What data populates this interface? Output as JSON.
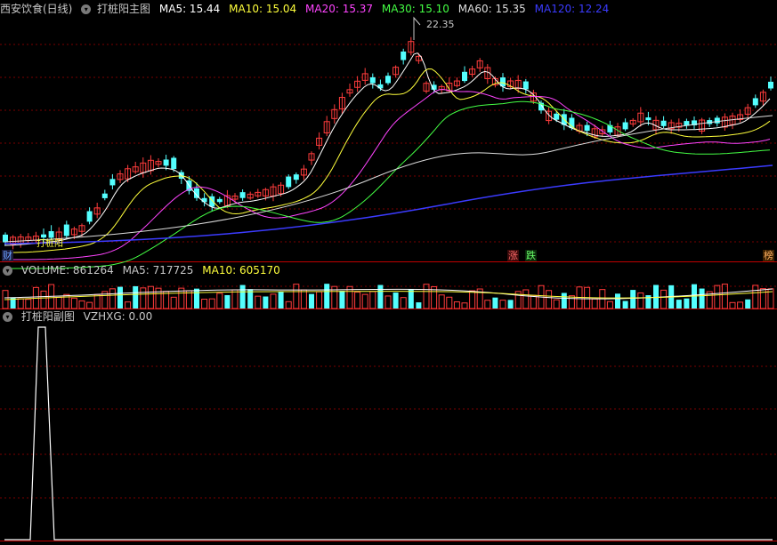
{
  "main_panel": {
    "stock_name": "西安饮食(日线)",
    "indicator_name": "打桩阳主图",
    "mas": [
      {
        "label": "MA5: 15.44",
        "color": "#ffffff"
      },
      {
        "label": "MA10: 15.04",
        "color": "#ffff3c"
      },
      {
        "label": "MA20: 15.37",
        "color": "#ff44ff"
      },
      {
        "label": "MA30: 15.10",
        "color": "#44ff44"
      },
      {
        "label": "MA60: 15.35",
        "color": "#dddddd"
      },
      {
        "label": "MA120: 12.24",
        "color": "#3b3bff"
      }
    ],
    "high_label": "22.35",
    "inline_label": "打桩阳",
    "markers": {
      "cai": "财",
      "zhang": "涨",
      "die": "跌",
      "bang": "榜"
    }
  },
  "volume_panel": {
    "label": "VOLUME: 861264",
    "ma5": "MA5: 717725",
    "ma10": "MA10: 605170"
  },
  "sub_panel": {
    "indicator_name": "打桩阳副图",
    "value": "VZHXG: 0.00"
  },
  "colors": {
    "up": "#ff3c3c",
    "down": "#54ffff",
    "grid": "#7a0000",
    "border": "#c00000"
  }
}
